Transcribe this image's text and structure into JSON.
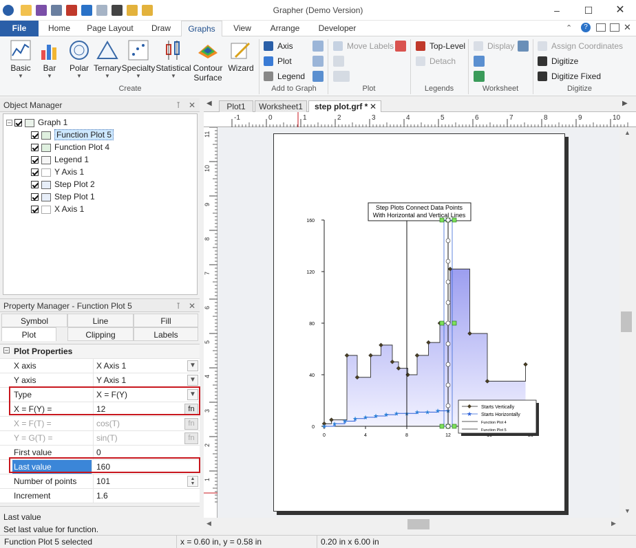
{
  "app": {
    "title": "Grapher (Demo Version)"
  },
  "ribbon_tabs": [
    "File",
    "Home",
    "Page Layout",
    "Draw",
    "Graphs",
    "View",
    "Arrange",
    "Developer"
  ],
  "ribbon": {
    "create_buttons": [
      "Basic",
      "Bar",
      "Polar",
      "Ternary",
      "Specialty",
      "Statistical",
      "Contour",
      "Surface",
      "Wizard"
    ],
    "create_group": "Create",
    "add_to_graph": {
      "items": [
        "Axis",
        "Plot",
        "Legend"
      ],
      "group": "Add to Graph"
    },
    "plot": {
      "items": [
        "Move Labels"
      ],
      "group": "Plot"
    },
    "legends": {
      "items": [
        "Top-Level",
        "Detach"
      ],
      "group": "Legends"
    },
    "worksheet": {
      "items": [
        "Display"
      ],
      "group": "Worksheet"
    },
    "digitize": {
      "items": [
        "Assign Coordinates",
        "Digitize",
        "Digitize Fixed"
      ],
      "group": "Digitize"
    }
  },
  "object_manager": {
    "title": "Object Manager",
    "root": "Graph 1",
    "items": [
      "Function Plot 5",
      "Function Plot 4",
      "Legend 1",
      "Y Axis 1",
      "Step Plot 2",
      "Step Plot 1",
      "X Axis 1"
    ]
  },
  "property_manager": {
    "title": "Property Manager - Function Plot 5",
    "tabs": [
      "Symbol",
      "Line",
      "Fill",
      "Plot",
      "Clipping",
      "Labels"
    ],
    "section": "Plot Properties",
    "rows": [
      {
        "label": "X axis",
        "value": "X Axis 1"
      },
      {
        "label": "Y axis",
        "value": "Y Axis 1"
      },
      {
        "label": "Type",
        "value": "X = F(Y)"
      },
      {
        "label": "X = F(Y) =",
        "value": "12",
        "button": "fn"
      },
      {
        "label": "X = F(T) =",
        "value": "cos(T)",
        "button": "fn"
      },
      {
        "label": "Y = G(T) =",
        "value": "sin(T)",
        "button": "fn"
      },
      {
        "label": "First value",
        "value": "0"
      },
      {
        "label": "Last value",
        "value": "160"
      },
      {
        "label": "Number of points",
        "value": "101"
      },
      {
        "label": "Increment",
        "value": "1.6"
      }
    ],
    "help_title": "Last value",
    "help_text": "Set last value for function."
  },
  "doc_tabs": [
    "Plot1",
    "Worksheet1",
    "step plot.grf *"
  ],
  "ruler_top": [
    "-1",
    "0",
    "1",
    "2",
    "3",
    "4",
    "5",
    "6",
    "7",
    "8",
    "9",
    "10"
  ],
  "ruler_left": [
    "11",
    "10",
    "9",
    "8",
    "7",
    "6",
    "5",
    "4",
    "3",
    "2",
    "1"
  ],
  "graph": {
    "title_line1": "Step Plots Connect Data Points",
    "title_line2": "With Horizontal and Vertical Lines",
    "y_ticks": [
      "0",
      "40",
      "80",
      "120",
      "160"
    ],
    "x_ticks": [
      "0",
      "4",
      "8",
      "12",
      "16",
      "20"
    ],
    "legend": [
      "Starts Vertically",
      "Starts Horizontally",
      "Function Plot 4",
      "Function Plot 5"
    ]
  },
  "chart_data": {
    "type": "line",
    "xlim": [
      0,
      20
    ],
    "ylim": [
      0,
      160
    ],
    "series": [
      {
        "name": "Starts Vertically",
        "x": [
          0,
          0.7,
          2.2,
          3.2,
          4.5,
          5.5,
          6.6,
          7.2,
          8.1,
          9.0,
          10.1,
          11.2,
          12.2,
          14.1,
          15.8,
          19.5
        ],
        "y": [
          2,
          5,
          55,
          38,
          55,
          63,
          50,
          45,
          40,
          55,
          65,
          80,
          122,
          72,
          35,
          48
        ]
      },
      {
        "name": "Starts Horizontally",
        "x": [
          0,
          1,
          2,
          3,
          4,
          5,
          6,
          7,
          8,
          9,
          10,
          11,
          12
        ],
        "y": [
          0,
          2,
          4,
          6,
          7,
          8,
          9,
          10,
          10,
          11,
          11,
          12,
          12
        ]
      },
      {
        "name": "Function Plot 4",
        "x": [
          8,
          8
        ],
        "y": [
          0,
          160
        ]
      },
      {
        "name": "Function Plot 5",
        "x": [
          12,
          12
        ],
        "y": [
          0,
          160
        ]
      }
    ]
  },
  "status": {
    "left": "Function Plot 5 selected",
    "coords": "x = 0.60 in, y = 0.58 in",
    "size": "0.20 in x 6.00 in"
  }
}
